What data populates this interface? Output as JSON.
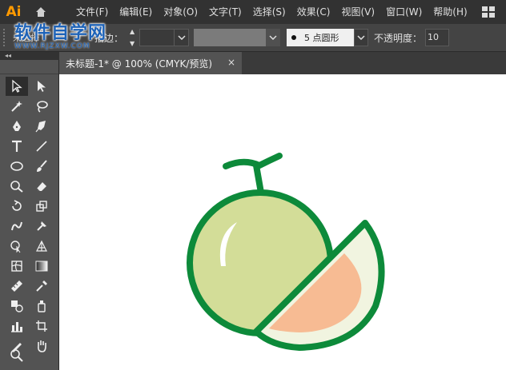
{
  "app": {
    "logo_text": "Ai",
    "document_tab": "未标题-1* @ 100% (CMYK/预览)",
    "close_glyph": "×"
  },
  "menu": [
    "文件(F)",
    "编辑(E)",
    "对象(O)",
    "文字(T)",
    "选择(S)",
    "效果(C)",
    "视图(V)",
    "窗口(W)",
    "帮助(H)"
  ],
  "watermark": {
    "title": "软件自学网",
    "url": "WWW.RJZXW.COM"
  },
  "controlbar": {
    "selection_label": "未选择",
    "stroke_label": "描边：",
    "brush_label": "5 点圆形",
    "opacity_label": "不透明度：",
    "opacity_value": "10"
  },
  "tools_head": "◂◂",
  "colors": {
    "outline": "#0d8a3a",
    "melon_flesh": "#d3dd98",
    "slice_rind": "#f1f4e0",
    "slice_flesh": "#f7bb93",
    "highlight": "#ffffff"
  }
}
